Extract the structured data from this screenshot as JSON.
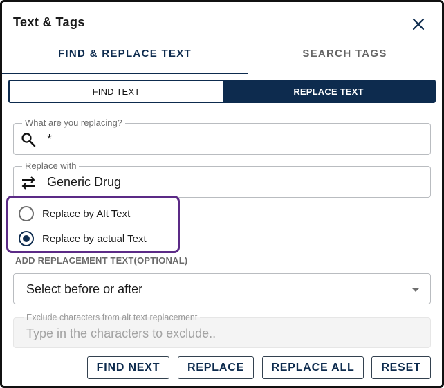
{
  "dialog": {
    "title": "Text & Tags",
    "close_icon": "close-icon"
  },
  "tabs": [
    {
      "label": "FIND & REPLACE TEXT",
      "active": true
    },
    {
      "label": "SEARCH TAGS",
      "active": false
    }
  ],
  "mode_toggle": {
    "find_label": "FIND TEXT",
    "replace_label": "REPLACE TEXT",
    "selected": "replace"
  },
  "search_field": {
    "label": "What are you replacing?",
    "value": "*",
    "icon": "search-icon"
  },
  "replace_field": {
    "label": "Replace with",
    "value": "Generic Drug",
    "icon": "swap-arrows-icon"
  },
  "replace_options": [
    {
      "label": "Replace by Alt Text",
      "checked": false
    },
    {
      "label": "Replace by actual Text",
      "checked": true
    }
  ],
  "replacement_section": {
    "label": "ADD REPLACEMENT TEXT(OPTIONAL)",
    "select_value": "Select before or after"
  },
  "exclude_field": {
    "label": "Exclude characters from alt text replacement",
    "placeholder": "Type in the characters to exclude.."
  },
  "actions": {
    "find_next": "FIND NEXT",
    "replace": "REPLACE",
    "replace_all": "REPLACE ALL",
    "reset": "RESET"
  },
  "colors": {
    "primary": "#0d2b4e",
    "highlight_border": "#5b2a86"
  }
}
